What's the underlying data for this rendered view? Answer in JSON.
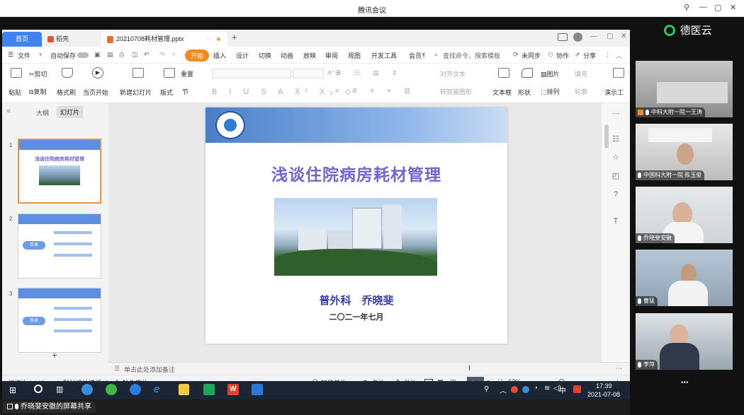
{
  "meeting": {
    "window_title": "腾讯会议",
    "share_label": "乔晓斐安徽的屏幕共享",
    "logo_text": "德医云"
  },
  "wps": {
    "tabs": [
      {
        "label": "首页"
      },
      {
        "label": "稻壳"
      },
      {
        "label": "20210708耗材管理.pptx"
      }
    ],
    "menu": {
      "file": "文件",
      "autosave": "自动保存",
      "start": "开始",
      "insert": "插入",
      "design": "设计",
      "switch": "切换",
      "animation": "动画",
      "slideshow": "放映",
      "review": "审阅",
      "view": "视图",
      "devtools": "开发工具",
      "member": "会员专",
      "search": "查找命令、搜索模板",
      "unsync": "未同步",
      "collab": "协作",
      "share": "分享"
    },
    "ribbon": {
      "paste": "粘贴",
      "cut": "剪切",
      "copy": "复制",
      "format_painter": "格式刷",
      "from_current": "当页开始",
      "new_slide": "新建幻灯片",
      "layout": "版式",
      "section": "节",
      "reset": "重置",
      "align_text": "对齐文本",
      "smart_shape": "转智能图形",
      "textbox": "文本框",
      "shape": "形状",
      "picture": "图片",
      "arrange": "排列",
      "fill": "填充",
      "outline": "轮廓",
      "present": "演示工"
    },
    "left_panel": {
      "outline_tab": "大纲",
      "slides_tab": "幻灯片",
      "thumb1_title": "浅谈住院病房耗材管理",
      "thumb_toc": "目录",
      "slide_numbers": [
        "1",
        "2",
        "3"
      ]
    },
    "slide": {
      "title": "浅谈住院病房耗材管理",
      "author": "普外科　乔晓斐",
      "date": "二〇二一年七月"
    },
    "notes_placeholder": "单击此处添加备注",
    "status": {
      "slide_count": "幻灯片 1 / 40",
      "template": "1_默认设计模板_2",
      "missing_font": "缺失字体",
      "smart_beautify": "智能美化",
      "notes": "备注",
      "comments": "批注",
      "zoom": "63%"
    }
  },
  "taskbar": {
    "time": "17:39",
    "date": "2021-07-08",
    "ime": "中"
  },
  "participants": [
    {
      "name": "中科大附一院一王涛"
    },
    {
      "name": "中国科大附一院 陈玉俊"
    },
    {
      "name": "乔晓斐安徽"
    },
    {
      "name": "曹猛"
    },
    {
      "name": "李萍"
    }
  ],
  "colors": {
    "accent": "#3f82f0",
    "start_button": "#f48a1e",
    "slide_title": "#6f67c9",
    "slide_author": "#3b3fa4",
    "meeting_logo": "#2dc26b"
  }
}
